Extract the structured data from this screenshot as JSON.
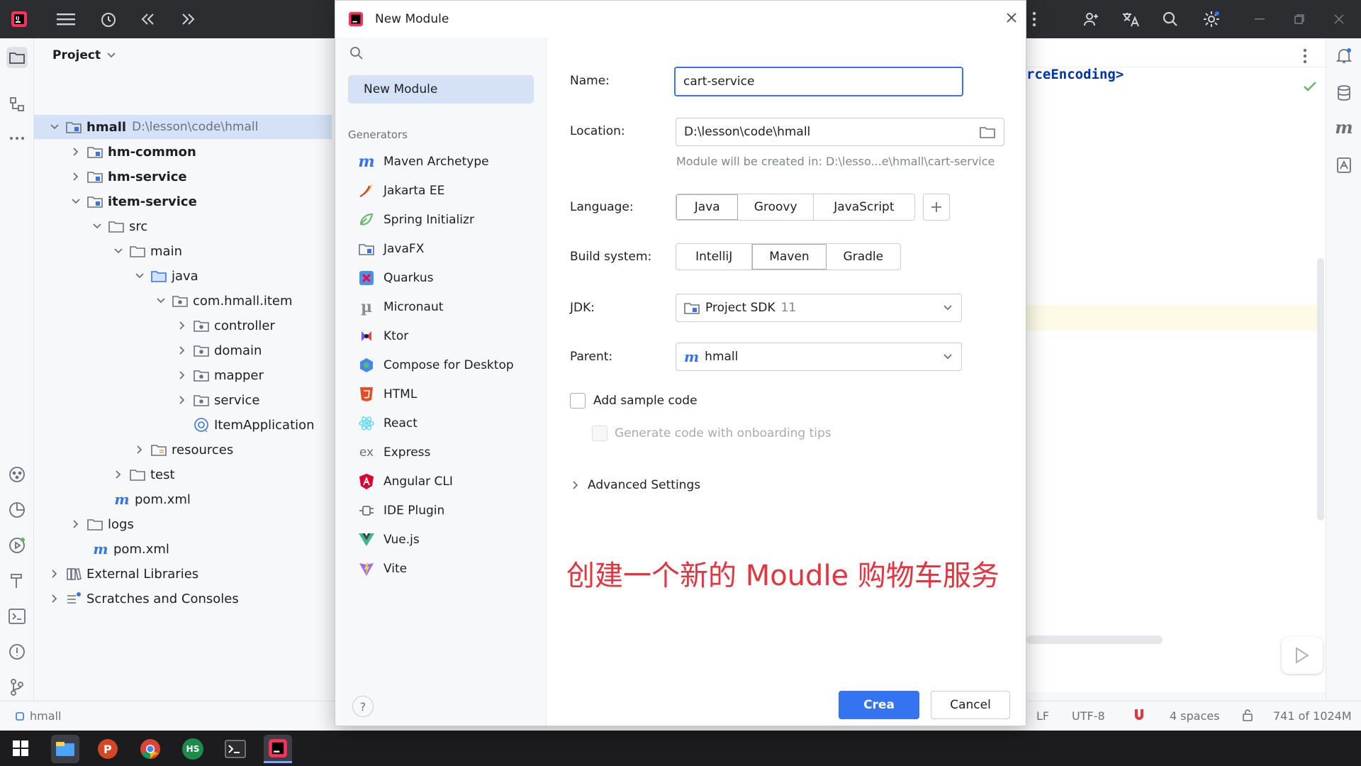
{
  "dialog": {
    "title": "New Module",
    "search_placeholder": "",
    "selected_item": "New Module",
    "generators_heading": "Generators",
    "generators": [
      {
        "label": "Maven Archetype",
        "icon": "maven-icon"
      },
      {
        "label": "Jakarta EE",
        "icon": "jakarta-ee-icon"
      },
      {
        "label": "Spring Initializr",
        "icon": "spring-icon"
      },
      {
        "label": "JavaFX",
        "icon": "javafx-icon"
      },
      {
        "label": "Quarkus",
        "icon": "quarkus-icon"
      },
      {
        "label": "Micronaut",
        "icon": "micronaut-icon"
      },
      {
        "label": "Ktor",
        "icon": "ktor-icon"
      },
      {
        "label": "Compose for Desktop",
        "icon": "compose-icon"
      },
      {
        "label": "HTML",
        "icon": "html5-icon"
      },
      {
        "label": "React",
        "icon": "react-icon"
      },
      {
        "label": "Express",
        "icon": "express-icon"
      },
      {
        "label": "Angular CLI",
        "icon": "angular-icon"
      },
      {
        "label": "IDE Plugin",
        "icon": "ide-plugin-icon"
      },
      {
        "label": "Vue.js",
        "icon": "vue-icon"
      },
      {
        "label": "Vite",
        "icon": "vite-icon"
      }
    ],
    "name_label": "Name:",
    "name_value": "cart-service",
    "location_label": "Location:",
    "location_value": "D:\\lesson\\code\\hmall",
    "location_hint": "Module will be created in: D:\\lesso...e\\hmall\\cart-service",
    "language_label": "Language:",
    "languages": [
      "Java",
      "Groovy",
      "JavaScript"
    ],
    "build_label": "Build system:",
    "build_systems": [
      "IntelliJ",
      "Maven",
      "Gradle"
    ],
    "jdk_label": "JDK:",
    "jdk_value": "Project SDK",
    "jdk_version": "11",
    "parent_label": "Parent:",
    "parent_value": "hmall",
    "sample_code_label": "Add sample code",
    "onboarding_label": "Generate code with onboarding tips",
    "advanced_label": "Advanced Settings",
    "annotation": "创建一个新的 Moudle 购物车服务",
    "create_label": "Crea",
    "cancel_label": "Cancel",
    "help_label": "?"
  },
  "project": {
    "header": "Project",
    "tree": [
      {
        "label": "hmall",
        "path": "D:\\lesson\\code\\hmall"
      },
      {
        "label": "hm-common"
      },
      {
        "label": "hm-service"
      },
      {
        "label": "item-service"
      },
      {
        "label": "src"
      },
      {
        "label": "main"
      },
      {
        "label": "java"
      },
      {
        "label": "com.hmall.item"
      },
      {
        "label": "controller"
      },
      {
        "label": "domain"
      },
      {
        "label": "mapper"
      },
      {
        "label": "service"
      },
      {
        "label": "ItemApplication"
      },
      {
        "label": "resources"
      },
      {
        "label": "test"
      },
      {
        "label": "pom.xml"
      },
      {
        "label": "logs"
      },
      {
        "label": "pom.xml"
      },
      {
        "label": "External Libraries"
      },
      {
        "label": "Scratches and Consoles"
      }
    ]
  },
  "editor": {
    "code_fragment": "rceEncoding>"
  },
  "status": {
    "project": "hmall",
    "line_ending": "LF",
    "encoding": "UTF-8",
    "indent": "4 spaces",
    "memory": "741 of 1024M"
  },
  "taskbar": {
    "hs_label": "HS"
  },
  "colors": {
    "accent": "#3574f0",
    "annotation": "#e8323c",
    "selection": "#d5e1f6"
  }
}
